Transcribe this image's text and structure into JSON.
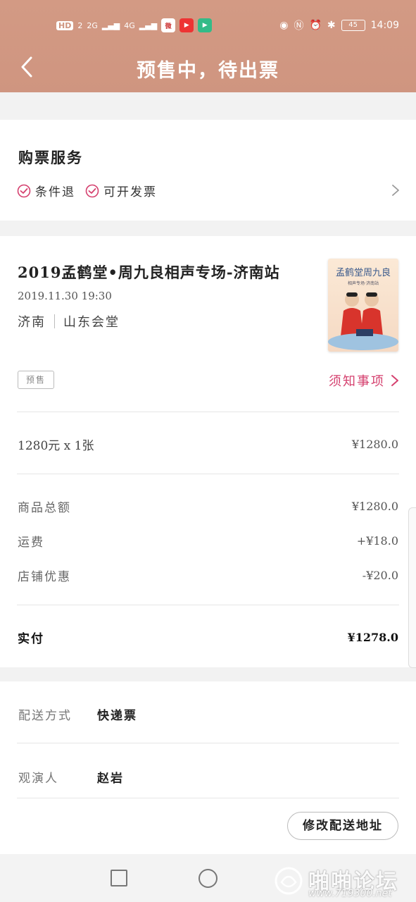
{
  "status_bar": {
    "left_badges": [
      "HD",
      "2",
      "2G",
      "4G"
    ],
    "time": "14:09",
    "battery": "45"
  },
  "header": {
    "title": "预售中，待出票"
  },
  "service": {
    "title": "购票服务",
    "tags": [
      "条件退",
      "可开发票"
    ]
  },
  "show": {
    "name": "2019孟鹤堂•周九良相声专场-济南站",
    "datetime": "2019.11.30 19:30",
    "city": "济南",
    "venue": "山东会堂",
    "poster_title": "孟鹤堂周九良",
    "poster_subtitle": "相声专场·济南站",
    "presale_badge": "预售",
    "notice_label": "须知事项"
  },
  "pricing": {
    "quantity_line": "1280元 x 1张",
    "quantity_amount": "¥1280.0",
    "rows": [
      {
        "label": "商品总额",
        "value": "¥1280.0"
      },
      {
        "label": "运费",
        "value": "+¥18.0"
      },
      {
        "label": "店铺优惠",
        "value": "-¥20.0"
      }
    ],
    "paid_label": "实付",
    "paid_value": "¥1278.0"
  },
  "delivery": {
    "method_label": "配送方式",
    "method_value": "快递票",
    "viewer_label": "观演人",
    "viewer_value": "赵岩",
    "modify_button": "修改配送地址"
  },
  "watermark": {
    "main": "啪啪论坛",
    "url": "www.719300.net"
  },
  "colors": {
    "header": "#d39a84",
    "accent": "#d5416f"
  }
}
